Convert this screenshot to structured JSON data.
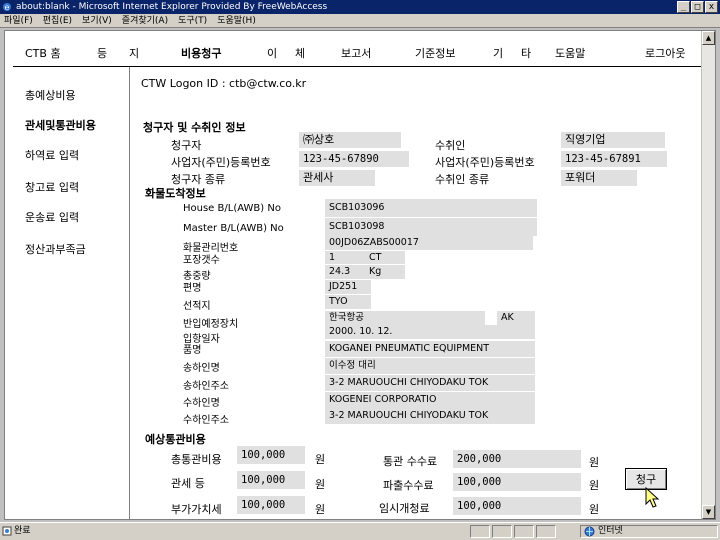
{
  "window": {
    "title": "about:blank - Microsoft Internet Explorer Provided By FreeWebAccess",
    "menus": [
      "파일(F)",
      "편집(E)",
      "보기(V)",
      "즐겨찾기(A)",
      "도구(T)",
      "도움말(H)"
    ],
    "min": "_",
    "max": "□",
    "close": "x"
  },
  "nav": {
    "items": [
      "CTB 홈",
      "등",
      "지",
      "비용청구",
      "이",
      "체",
      "보고서",
      "기준정보",
      "기",
      "타",
      "도움말",
      "로그아웃"
    ]
  },
  "sidebar": {
    "items": [
      "총예상비용",
      "관세및통관비용",
      "하역료 입력",
      "창고료 입력",
      "운송료 입력",
      "정산과부족금"
    ]
  },
  "logon": "CTW Logon ID : ctb@ctw.co.kr",
  "claimant": {
    "title": "청구자 및 수취인 정보",
    "claimant_label": "청구자",
    "claimant_value": "㈜상호",
    "claimant_reg_label": "사업자(주민)등록번호",
    "claimant_reg_value": "123-45-67890",
    "claimant_type_label": "청구자 종류",
    "claimant_type_value": "관세사",
    "payee_label": "수취인",
    "payee_value": "직영기업",
    "payee_reg_label": "사업자(주민)등록번호",
    "payee_reg_value": "123-45-67891",
    "payee_type_label": "수취인 종류",
    "payee_type_value": "포워더"
  },
  "cargo": {
    "title": "화물도착정보",
    "house_bl_label": "House B/L(AWB) No",
    "house_bl_value": "SCB103096",
    "master_bl_label": "Master B/L(AWB) No",
    "master_bl_value": "SCB103098",
    "cargo_no_label": "화물관리번호",
    "cargo_no_value": "00JD06ZABS00017",
    "packages_label": "포장갯수",
    "packages_value": "1",
    "packages_unit": "CT",
    "weight_label": "총중량",
    "weight_value": "24.3",
    "weight_unit": "Kg",
    "flight_label": "편명",
    "flight_value": "JD251",
    "port_label": "선적지",
    "port_value": "TYO",
    "warehouse_label": "반입예정장치",
    "warehouse_value": "한국항공",
    "warehouse_code": "AK",
    "arrival_date_label": "입항일자",
    "arrival_date_value": "2000. 10. 12.",
    "item_label": "품명",
    "item_value": "KOGANEI PNEUMATIC EQUIPMENT",
    "shipper_label": "송하인명",
    "shipper_value": "이수정 대리",
    "shipper_addr_label": "송하인주소",
    "shipper_addr_value": "3-2 MARUOUCHI CHIYODAKU TOK",
    "consignee_label": "수하인명",
    "consignee_value": "KOGENEI CORPORATIO",
    "consignee_addr_label": "수하인주소",
    "consignee_addr_value": "3-2 MARUOUCHI CHIYODAKU TOK"
  },
  "costs": {
    "title": "예상통관비용",
    "customs_fee_label": "총통관비용",
    "customs_fee_value": "100,000",
    "duty_label": "관세 등",
    "duty_value": "100,000",
    "vat_label": "부가가치세",
    "vat_value": "100,000",
    "clearance_fee_label": "통관 수수료",
    "clearance_fee_value": "200,000",
    "handling_fee_label": "파출수수료",
    "handling_fee_value": "100,000",
    "temp_fee_label": "임시개청료",
    "temp_fee_value": "100,000",
    "currency": "원",
    "claim_button": "청구"
  },
  "status": {
    "text": "완료",
    "zone": "인터넷"
  }
}
